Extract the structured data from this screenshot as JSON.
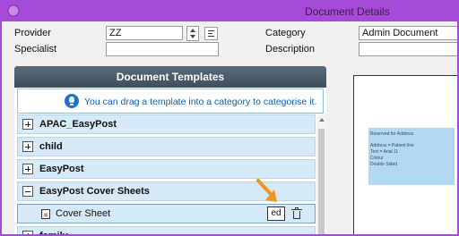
{
  "window": {
    "title": "Document Details"
  },
  "form": {
    "provider_label": "Provider",
    "provider_value": "ZZ",
    "specialist_label": "Specialist",
    "specialist_value": "",
    "category_label": "Category",
    "category_value": "Admin Document",
    "description_label": "Description",
    "description_value": ""
  },
  "templates": {
    "title": "Document Templates",
    "hint": "You can drag a template into a category to categorise it.",
    "groups": [
      {
        "name": "APAC_EasyPost",
        "expanded": false
      },
      {
        "name": "child",
        "expanded": false
      },
      {
        "name": "EasyPost",
        "expanded": false
      },
      {
        "name": "EasyPost Cover Sheets",
        "expanded": true
      },
      {
        "name": "family",
        "expanded": false
      }
    ],
    "selected_item": "Cover Sheet",
    "edit_label": "ed"
  },
  "preview": {
    "lines": [
      "Reserved for Address",
      "Address = Patient line",
      "Text = Arial 11",
      "Colour",
      "Double Sided"
    ]
  },
  "colors": {
    "title_bar": "#a64bd8",
    "panel_header": "#4a5a6a",
    "row_bg": "#d6e9f7",
    "hint_text": "#0b5fb0",
    "arrow": "#f0961e"
  }
}
